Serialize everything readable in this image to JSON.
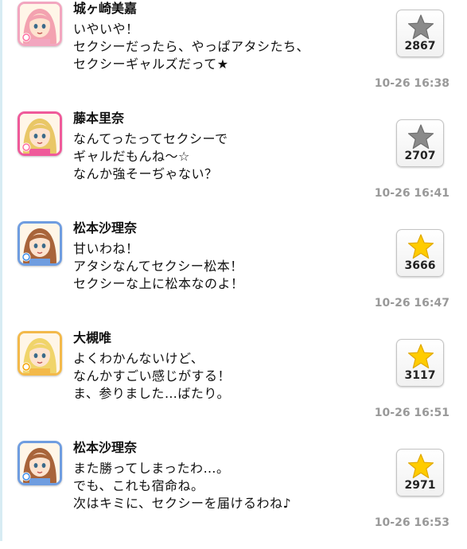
{
  "posts": [
    {
      "name": "城ヶ崎美嘉",
      "lines": [
        "いやいや！",
        "セクシーだったら、やっぱアタシたち、",
        "セクシーギャルズだって★"
      ],
      "likes": "2867",
      "liked": false,
      "time": "10-26 16:38",
      "avatar_icon": "idol-avatar-icon",
      "attribute_icon": "cute-attribute-icon",
      "frame_color": "#f2a6bf",
      "hair_color": "#f3a2b0"
    },
    {
      "name": "藤本里奈",
      "lines": [
        "なんてったってセクシーで",
        "ギャルだもんね～☆",
        "なんか強そーぢゃない？"
      ],
      "likes": "2707",
      "liked": false,
      "time": "10-26 16:41",
      "avatar_icon": "idol-avatar-icon",
      "attribute_icon": "cute-attribute-icon",
      "frame_color": "#ef5a9a",
      "hair_color": "#e9c766"
    },
    {
      "name": "松本沙理奈",
      "lines": [
        "甘いわね！",
        "アタシなんてセクシー松本！",
        "セクシーな上に松本なのよ！"
      ],
      "likes": "3666",
      "liked": true,
      "time": "10-26 16:47",
      "avatar_icon": "idol-avatar-icon",
      "attribute_icon": "cool-attribute-icon",
      "frame_color": "#6f9de0",
      "hair_color": "#a8643a"
    },
    {
      "name": "大槻唯",
      "lines": [
        "よくわかんないけど、",
        "なんかすごい感じがする！",
        "ま、参りました…ばたり。"
      ],
      "likes": "3117",
      "liked": true,
      "time": "10-26 16:51",
      "avatar_icon": "idol-avatar-icon",
      "attribute_icon": "passion-attribute-icon",
      "frame_color": "#f3b94a",
      "hair_color": "#f0d46a"
    },
    {
      "name": "松本沙理奈",
      "lines": [
        "また勝ってしまったわ…。",
        "でも、これも宿命ね。",
        "次はキミに、セクシーを届けるわね♪"
      ],
      "likes": "2971",
      "liked": true,
      "time": "10-26 16:53",
      "avatar_icon": "idol-avatar-icon",
      "attribute_icon": "cool-attribute-icon",
      "frame_color": "#6f9de0",
      "hair_color": "#a8643a"
    }
  ],
  "colors": {
    "star_unliked": "#8a8a8a",
    "star_liked": "#ffcc00",
    "timestamp": "#999999",
    "cute": "#ff6fa0",
    "cool": "#3f8fe8",
    "passion": "#f5a300"
  }
}
